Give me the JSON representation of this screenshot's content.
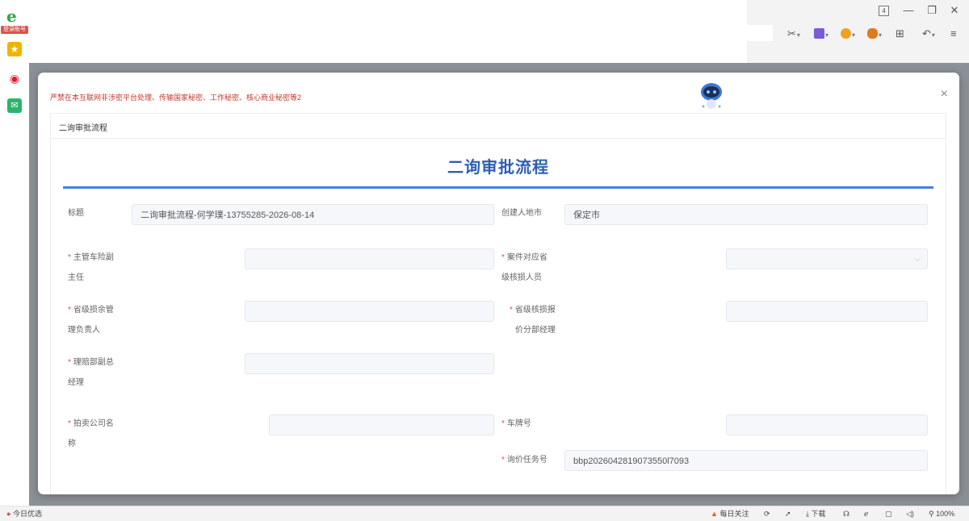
{
  "browser": {
    "tab_count": "4",
    "minimize_icon": "minimize-icon",
    "restore_icon": "restore-icon",
    "close_icon": "close-icon",
    "toolbar_icons": [
      "scissors-icon",
      "translate-icon",
      "shield-icon",
      "game-icon",
      "grid-icon",
      "undo-icon",
      "menu-icon"
    ]
  },
  "sidebar": {
    "login_badge": "登录账号",
    "items": [
      "ie-icon",
      "favorite-icon",
      "weibo-icon",
      "mail-icon"
    ]
  },
  "dialog": {
    "warning": "严禁在本互联网非涉密平台处理、传输国家秘密、工作秘密、核心商业秘密等2",
    "panel_title": "二询审批流程",
    "form_title": "二询审批流程",
    "fields": {
      "title_label": "标题",
      "title_value": "二询审批流程-何学璞-13755285-2026-08-14",
      "creator_city_label": "创建人地市",
      "creator_city_value": "保定市",
      "car_insurance_vice_label_1": "主管车险副",
      "car_insurance_vice_label_2": "主任",
      "case_province_label_1": "案件对应省",
      "case_province_label_2": "级核损人员",
      "province_residual_label_1": "省级损余管",
      "province_residual_label_2": "理负责人",
      "province_quote_label_1": "省级核损报",
      "province_quote_label_2": "价分部经理",
      "claims_vice_label_1": "理赔部副总",
      "claims_vice_label_2": "经理",
      "auction_company_label_1": "拍卖公司名",
      "auction_company_label_2": "称",
      "plate_label": "车牌号",
      "inquiry_task_label": "询价任务号",
      "inquiry_task_value": "bbp2026042819073550l7093"
    }
  },
  "statusbar": {
    "today_pick": "今日优选",
    "daily_follow": "每日关注",
    "download": "下载",
    "zoom": "100%"
  },
  "colors": {
    "accent": "#2f5fb3",
    "rule": "#4a7fd6",
    "warning": "#c0392b",
    "required": "#e5484d"
  }
}
